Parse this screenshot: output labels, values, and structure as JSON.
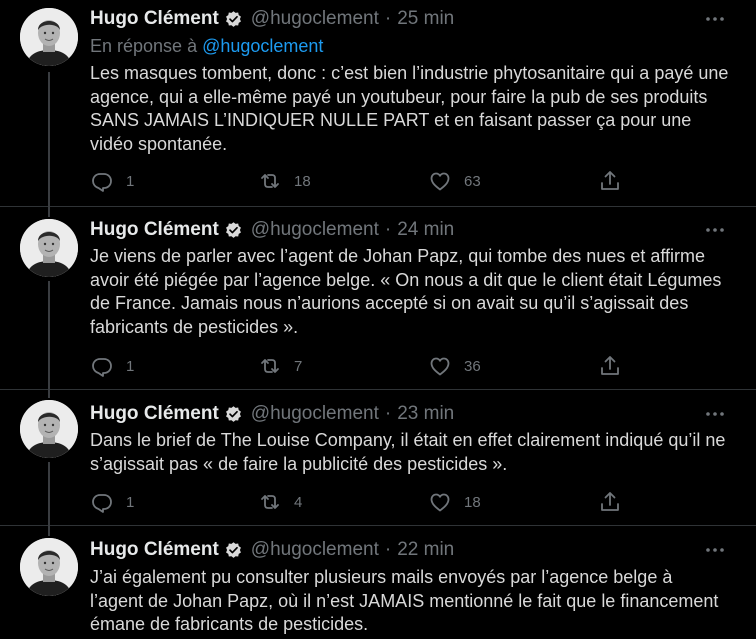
{
  "tweets": [
    {
      "name": "Hugo Clément",
      "handle": "@hugoclement",
      "time": "25 min",
      "replying_prefix": "En réponse à",
      "replying_handle": "@hugoclement",
      "text": "Les masques tombent, donc : c’est bien l’industrie phytosanitaire qui a payé une agence, qui a elle-même payé un youtubeur, pour faire la pub de ses produits SANS JAMAIS L’INDIQUER NULLE PART et en faisant passer ça pour une vidéo spontanée.",
      "replies": "1",
      "retweets": "18",
      "likes": "63"
    },
    {
      "name": "Hugo Clément",
      "handle": "@hugoclement",
      "time": "24 min",
      "text": "Je viens de parler avec l’agent de Johan Papz, qui tombe des nues et affirme avoir été piégée par l’agence belge. « On nous a dit que le client était Légumes de France. Jamais nous n’aurions accepté si on avait su qu’il s’agissait des fabricants de pesticides ».",
      "replies": "1",
      "retweets": "7",
      "likes": "36"
    },
    {
      "name": "Hugo Clément",
      "handle": "@hugoclement",
      "time": "23 min",
      "text": "Dans le brief de The Louise Company, il était en effet clairement indiqué qu’il ne s’agissait pas « de faire la publicité des pesticides ».",
      "replies": "1",
      "retweets": "4",
      "likes": "18"
    },
    {
      "name": "Hugo Clément",
      "handle": "@hugoclement",
      "time": "22 min",
      "text": "J’ai également pu consulter plusieurs mails envoyés par l’agence belge à l’agent de Johan Papz, où il n’est JAMAIS mentionné le fait que le financement émane de fabricants de pesticides."
    }
  ],
  "separator": "·",
  "icons": {
    "verified": "verified-badge-icon",
    "more": "more-icon",
    "reply": "reply-icon",
    "retweet": "retweet-icon",
    "like": "like-icon",
    "share": "share-icon"
  },
  "colors": {
    "background": "#000000",
    "text": "#d9d9d9",
    "muted": "#71767b",
    "link": "#1d9bf0",
    "divider": "#2f3336"
  }
}
